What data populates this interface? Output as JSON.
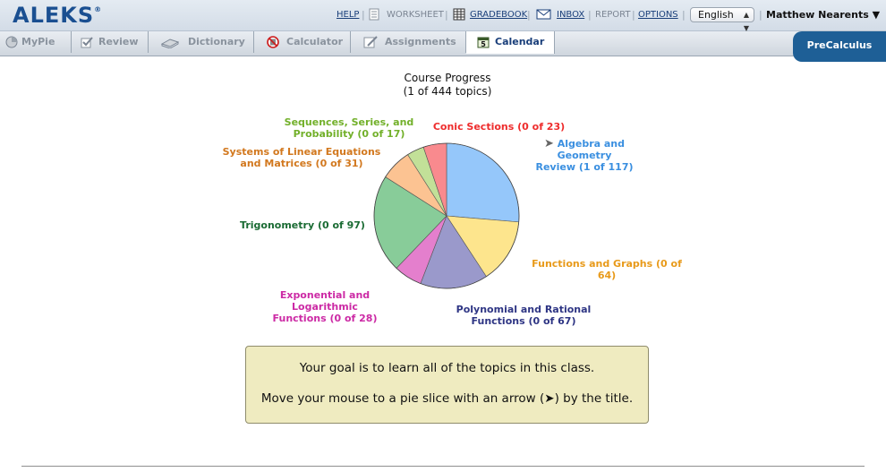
{
  "app": {
    "logo": "ALEKS",
    "logo_mark": "®"
  },
  "toolbar": {
    "help": "HELP",
    "worksheet": "WORKSHEET",
    "gradebook": "GRADEBOOK",
    "inbox": "INBOX",
    "report": "REPORT",
    "options": "OPTIONS",
    "language": "English",
    "user": "Matthew Nearents"
  },
  "tabs": [
    {
      "label": "MyPie",
      "icon": "pie-icon"
    },
    {
      "label": "Review",
      "icon": "checkbox-icon"
    },
    {
      "label": "Dictionary",
      "icon": "book-icon"
    },
    {
      "label": "Calculator",
      "icon": "no-calculator-icon"
    },
    {
      "label": "Assignments",
      "icon": "pencil-icon"
    },
    {
      "label": "Calendar",
      "icon": "calendar-icon",
      "icon_text": "5"
    }
  ],
  "course": "PreCalculus",
  "chart_data": {
    "type": "pie",
    "title": "Course Progress",
    "subtitle": "(1 of 444 topics)",
    "slices": [
      {
        "name": "Algebra and Geometry Review (1 of 117)",
        "line1": "Algebra and Geometry",
        "line2": "Review (1 of 117)",
        "value": 117,
        "color": "#95c7fa",
        "label_color": "#3a8fe0",
        "arrow": true
      },
      {
        "name": "Functions and Graphs (0 of 64)",
        "line1": "Functions and Graphs (0 of 64)",
        "line2": "",
        "value": 64,
        "color": "#fde58d",
        "label_color": "#e89a1a",
        "arrow": false
      },
      {
        "name": "Polynomial and Rational Functions (0 of 67)",
        "line1": "Polynomial and Rational",
        "line2": "Functions (0 of 67)",
        "value": 67,
        "color": "#9a99cb",
        "label_color": "#2e3584",
        "arrow": false
      },
      {
        "name": "Exponential and Logarithmic Functions (0 of 28)",
        "line1": "Exponential and Logarithmic",
        "line2": "Functions (0 of 28)",
        "value": 28,
        "color": "#e47fcd",
        "label_color": "#cc2aa5",
        "arrow": false
      },
      {
        "name": "Trigonometry (0 of 97)",
        "line1": "Trigonometry (0 of 97)",
        "line2": "",
        "value": 97,
        "color": "#88cc99",
        "label_color": "#1a6b33",
        "arrow": false
      },
      {
        "name": "Systems of Linear Equations and Matrices (0 of 31)",
        "line1": "Systems of Linear Equations",
        "line2": "and Matrices (0 of 31)",
        "value": 31,
        "color": "#fcc392",
        "label_color": "#d2781e",
        "arrow": false
      },
      {
        "name": "Sequences, Series, and Probability (0 of 17)",
        "line1": "Sequences, Series, and",
        "line2": "Probability (0 of 17)",
        "value": 17,
        "color": "#c2e098",
        "label_color": "#72b02a",
        "arrow": false
      },
      {
        "name": "Conic Sections (0 of 23)",
        "line1": "Conic Sections (0 of 23)",
        "line2": "",
        "value": 23,
        "color": "#f98a8e",
        "label_color": "#ee2c2c",
        "arrow": false
      }
    ]
  },
  "goal": {
    "line1": "Your goal is to learn all of the topics in this class.",
    "line2": "Move your mouse to a pie slice with an arrow (➤) by the title."
  }
}
